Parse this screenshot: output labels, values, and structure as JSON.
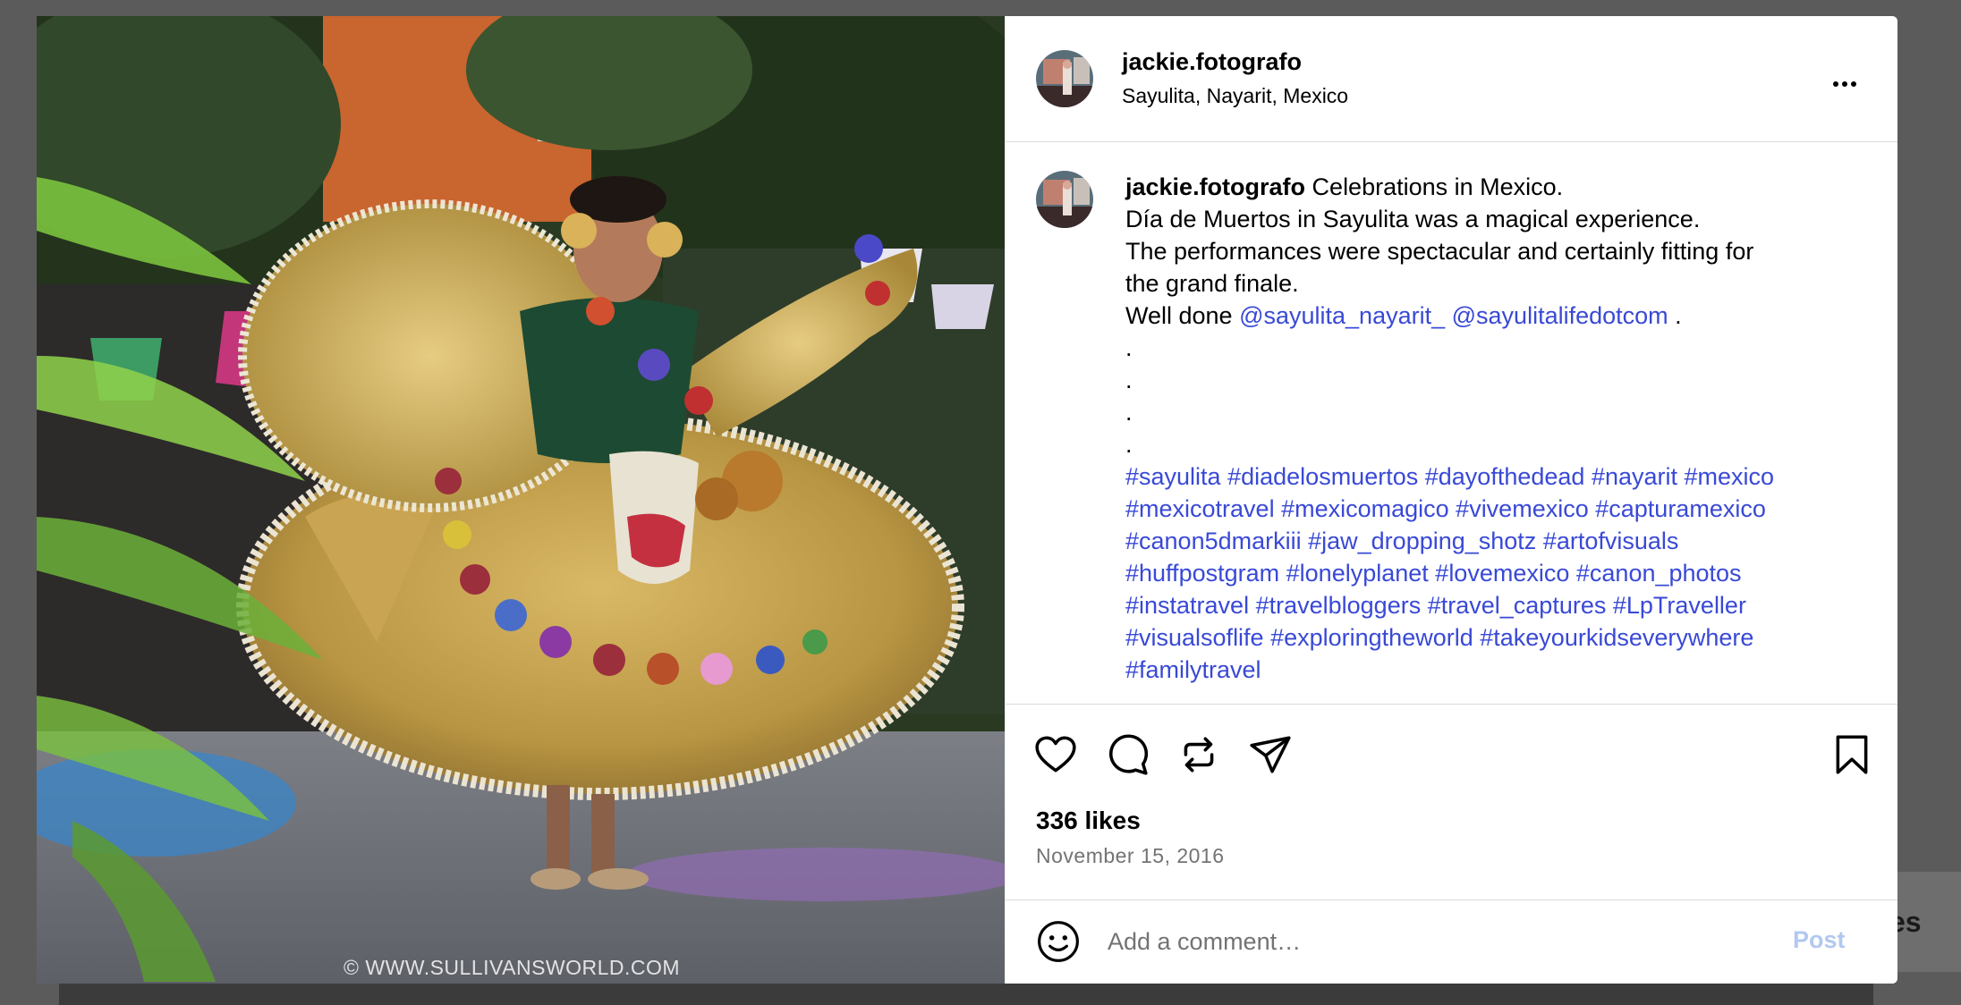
{
  "post": {
    "username": "jackie.fotografo",
    "location": "Sayulita, Nayarit, Mexico",
    "photo_alt": "Dancer in a gold folklórico dress",
    "watermark": "© WWW.SULLIVANSWORLD.COM"
  },
  "caption": {
    "username": "jackie.fotografo",
    "line1_text": " Celebrations in Mexico.",
    "line2": "Día de Muertos in Sayulita was a magical experience.",
    "line3": "The performances were spectacular and certainly fitting for",
    "line4": "the grand finale.",
    "line5_prefix": "Well done ",
    "mention1": "@sayulita_nayarit_",
    "mention2": "@sayulitalifedotcom",
    "line5_suffix": " .",
    "dots": [
      ".",
      ".",
      ".",
      "."
    ]
  },
  "hashtags": [
    [
      "#sayulita",
      "#diadelosmuertos",
      "#dayofthedead",
      "#nayarit",
      "#mexico"
    ],
    [
      "#mexicotravel",
      "#mexicomagico",
      "#vivemexico",
      "#capturamexico"
    ],
    [
      "#canon5dmarkiii",
      "#jaw_dropping_shotz",
      "#artofvisuals"
    ],
    [
      "#huffpostgram",
      "#lonelyplanet",
      "#lovemexico",
      "#canon_photos"
    ],
    [
      "#instatravel",
      "#travelbloggers",
      "#travel_captures",
      "#LpTraveller"
    ],
    [
      "#visualsoflife",
      "#exploringtheworld",
      "#takeyourkidseverywhere"
    ],
    [
      "#familytravel"
    ]
  ],
  "actions": {
    "icons": [
      "heart-icon",
      "comment-icon",
      "repost-icon",
      "share-icon",
      "bookmark-icon"
    ]
  },
  "stats": {
    "likes": "336 likes",
    "date": "November 15, 2016"
  },
  "comment": {
    "placeholder": "Add a comment…",
    "post_label": "Post"
  },
  "background": {
    "card_text": "es"
  },
  "colors": {
    "link": "#3949d6",
    "post_disabled": "#b2c8f0",
    "muted": "#737373",
    "overlay": "#5b5b5b"
  }
}
